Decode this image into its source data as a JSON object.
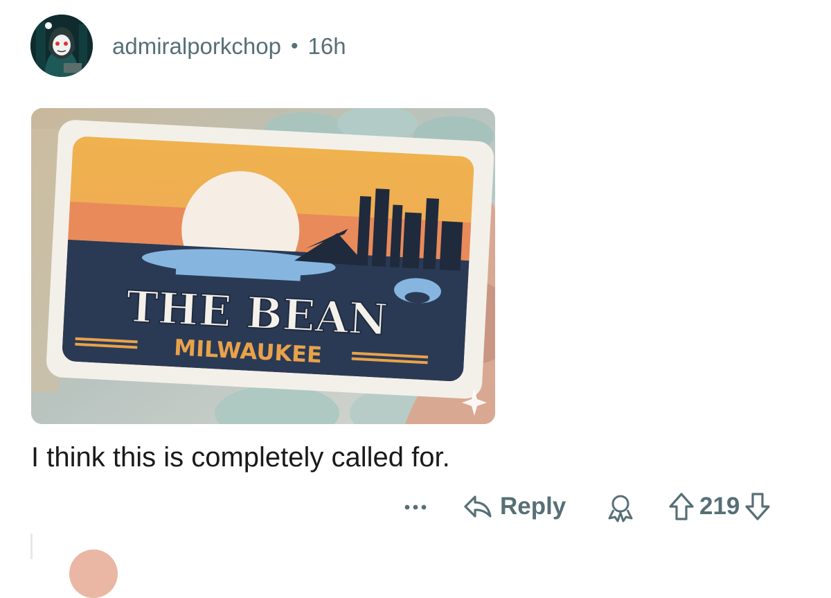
{
  "comment": {
    "username": "admiralporkchop",
    "separator": "•",
    "age": "16h",
    "text": "I think this is completely called for."
  },
  "image": {
    "card_title": "THE BEAN",
    "card_subtitle": "MILWAUKEE"
  },
  "actions": {
    "reply_label": "Reply",
    "vote_count": "219"
  },
  "icons": {
    "more": "more-horizontal-icon",
    "reply": "reply-arrow-icon",
    "award": "award-icon",
    "upvote": "upvote-arrow-icon",
    "downvote": "downvote-arrow-icon"
  },
  "colors": {
    "meta_text": "#576f76",
    "body_text": "#1a1a1b",
    "card_orange": "#e9a24a",
    "card_navy": "#2a3a55",
    "card_blue": "#86b6df"
  }
}
